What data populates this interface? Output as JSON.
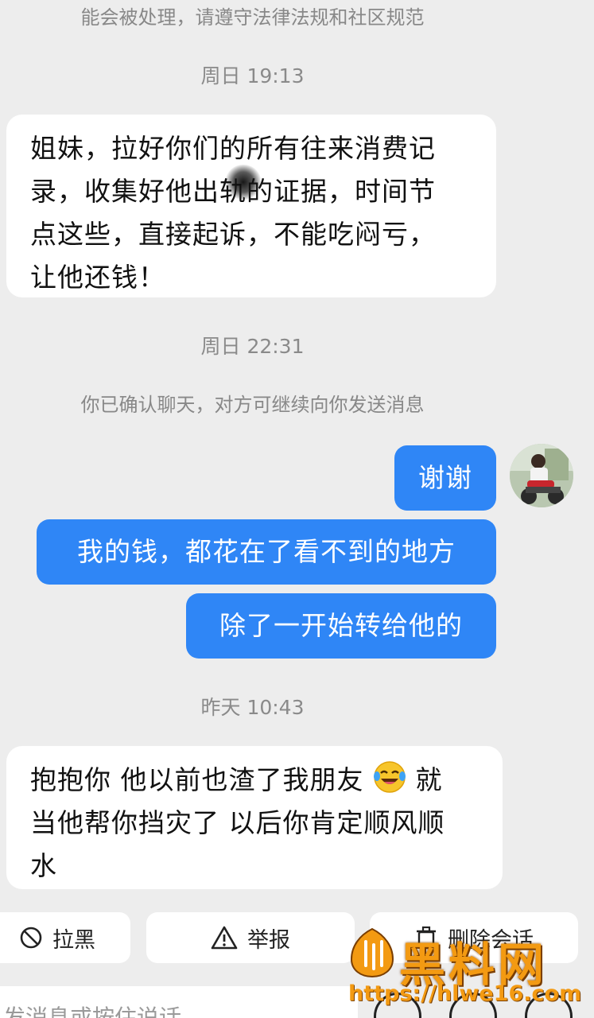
{
  "notices": {
    "top_notice": "能会被处理，请遵守法律法规和社区规范",
    "confirm_notice": "你已确认聊天，对方可继续向你发送消息"
  },
  "timestamps": {
    "t1": "周日 19:13",
    "t2": "周日 22:31",
    "t3": "昨天 10:43"
  },
  "messages": {
    "incoming_1": {
      "line1": "姐妹，拉好你们的所有往来消费记",
      "line2": "录，收集好他出轨的证据，时间节",
      "line3": "点这些，直接起诉，不能吃闷亏，",
      "line4": "让他还钱！"
    },
    "outgoing_1": "谢谢",
    "outgoing_2": "我的钱，都花在了看不到的地方",
    "outgoing_3": "除了一开始转给他的",
    "incoming_2": {
      "line1_a": "抱抱你 他以前也渣了我朋友",
      "line1_b": " 就",
      "line2": "当他帮你挡灾了 以后你肯定顺风顺",
      "line3": "水",
      "emoji": "laughing-crying-emoji"
    }
  },
  "actions": {
    "block_label": "拉黑",
    "report_label": "举报",
    "delete_label": "删除会话"
  },
  "input": {
    "placeholder": "发消息或按住说话"
  },
  "watermark": {
    "title": "黑料网",
    "url": "https://hlwe16.com"
  },
  "colors": {
    "outgoing_bubble": "#2f86f6",
    "incoming_bubble": "#ffffff",
    "background": "#ededed",
    "watermark": "#f39a12"
  }
}
